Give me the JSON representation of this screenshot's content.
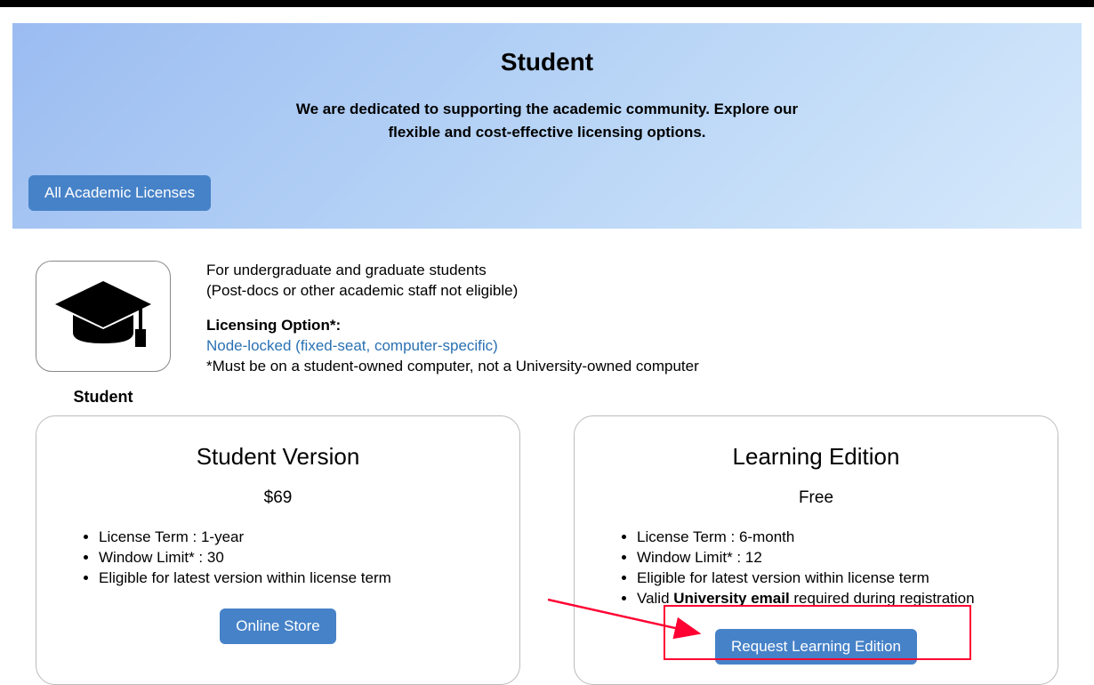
{
  "hero": {
    "title": "Student",
    "subtitle_line1": "We are dedicated to supporting the academic community. Explore our",
    "subtitle_line2": "flexible and cost-effective licensing options.",
    "all_licenses_button": "All Academic Licenses"
  },
  "student_icon_label": "Student",
  "info": {
    "line1": "For undergraduate and graduate students",
    "line2": "(Post-docs or other academic staff not eligible)",
    "licensing_option_label": "Licensing Option*:",
    "licensing_link": "Node-locked (fixed-seat, computer-specific)",
    "footnote": "*Must be on a student-owned computer, not a University-owned computer"
  },
  "cards": {
    "student_version": {
      "title": "Student Version",
      "price": "$69",
      "features": [
        "License Term : 1-year",
        "Window Limit* : 30",
        "Eligible for latest version within license term"
      ],
      "button": "Online Store"
    },
    "learning_edition": {
      "title": "Learning Edition",
      "price": "Free",
      "features": [
        "License Term : 6-month",
        "Window Limit* : 12",
        "Eligible for latest version within license term"
      ],
      "feature4_prefix": "Valid ",
      "feature4_bold": "University email",
      "feature4_suffix": " required during registration",
      "button": "Request Learning Edition"
    }
  }
}
